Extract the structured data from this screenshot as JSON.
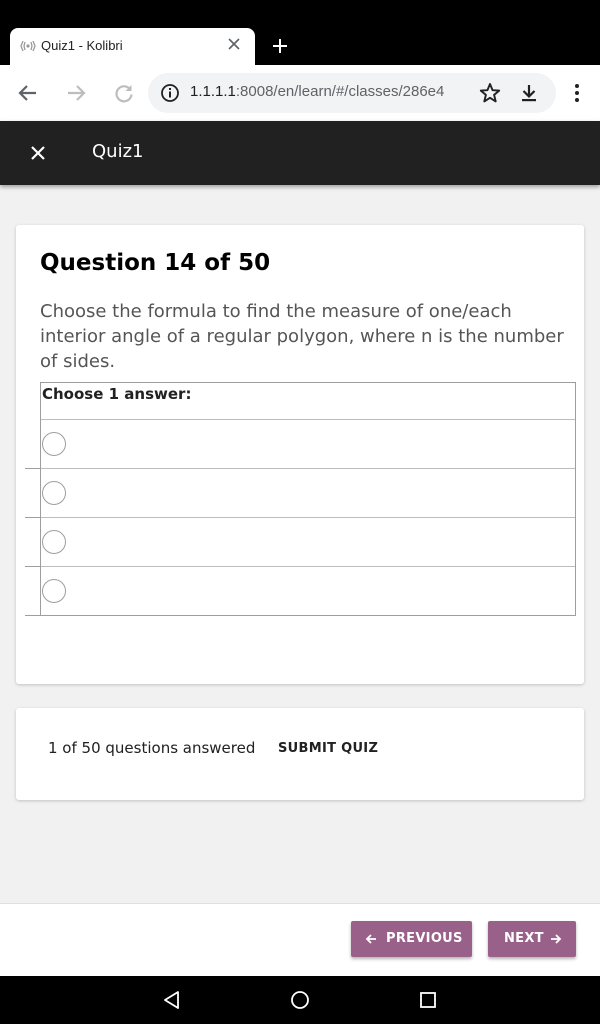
{
  "browser": {
    "tab_title": "Quiz1 - Kolibri",
    "url_host": "1.1.1.1",
    "url_rest": ":8008/en/learn/#/classes/286e4"
  },
  "appbar": {
    "title": "Quiz1"
  },
  "question": {
    "heading": "Question 14 of 50",
    "prompt": "Choose the formula to find the measure of one/each interior angle of a regular polygon, where n is the number of sides.",
    "answers_label": "Choose 1 answer:",
    "choices": [
      "",
      "",
      "",
      ""
    ]
  },
  "progress": {
    "answered_text": "1 of 50 questions answered",
    "submit_label": "SUBMIT QUIZ"
  },
  "nav": {
    "previous_label": "PREVIOUS",
    "next_label": "NEXT"
  },
  "colors": {
    "accent": "#996189",
    "appbar": "#212121"
  },
  "icons": [
    "kolibri-favicon",
    "close-icon",
    "plus-icon",
    "back-arrow-icon",
    "forward-arrow-icon",
    "reload-icon",
    "info-icon",
    "star-icon",
    "download-icon",
    "more-vert-icon",
    "arrow-left-icon",
    "arrow-right-icon",
    "android-back-icon",
    "android-home-icon",
    "android-recents-icon"
  ]
}
